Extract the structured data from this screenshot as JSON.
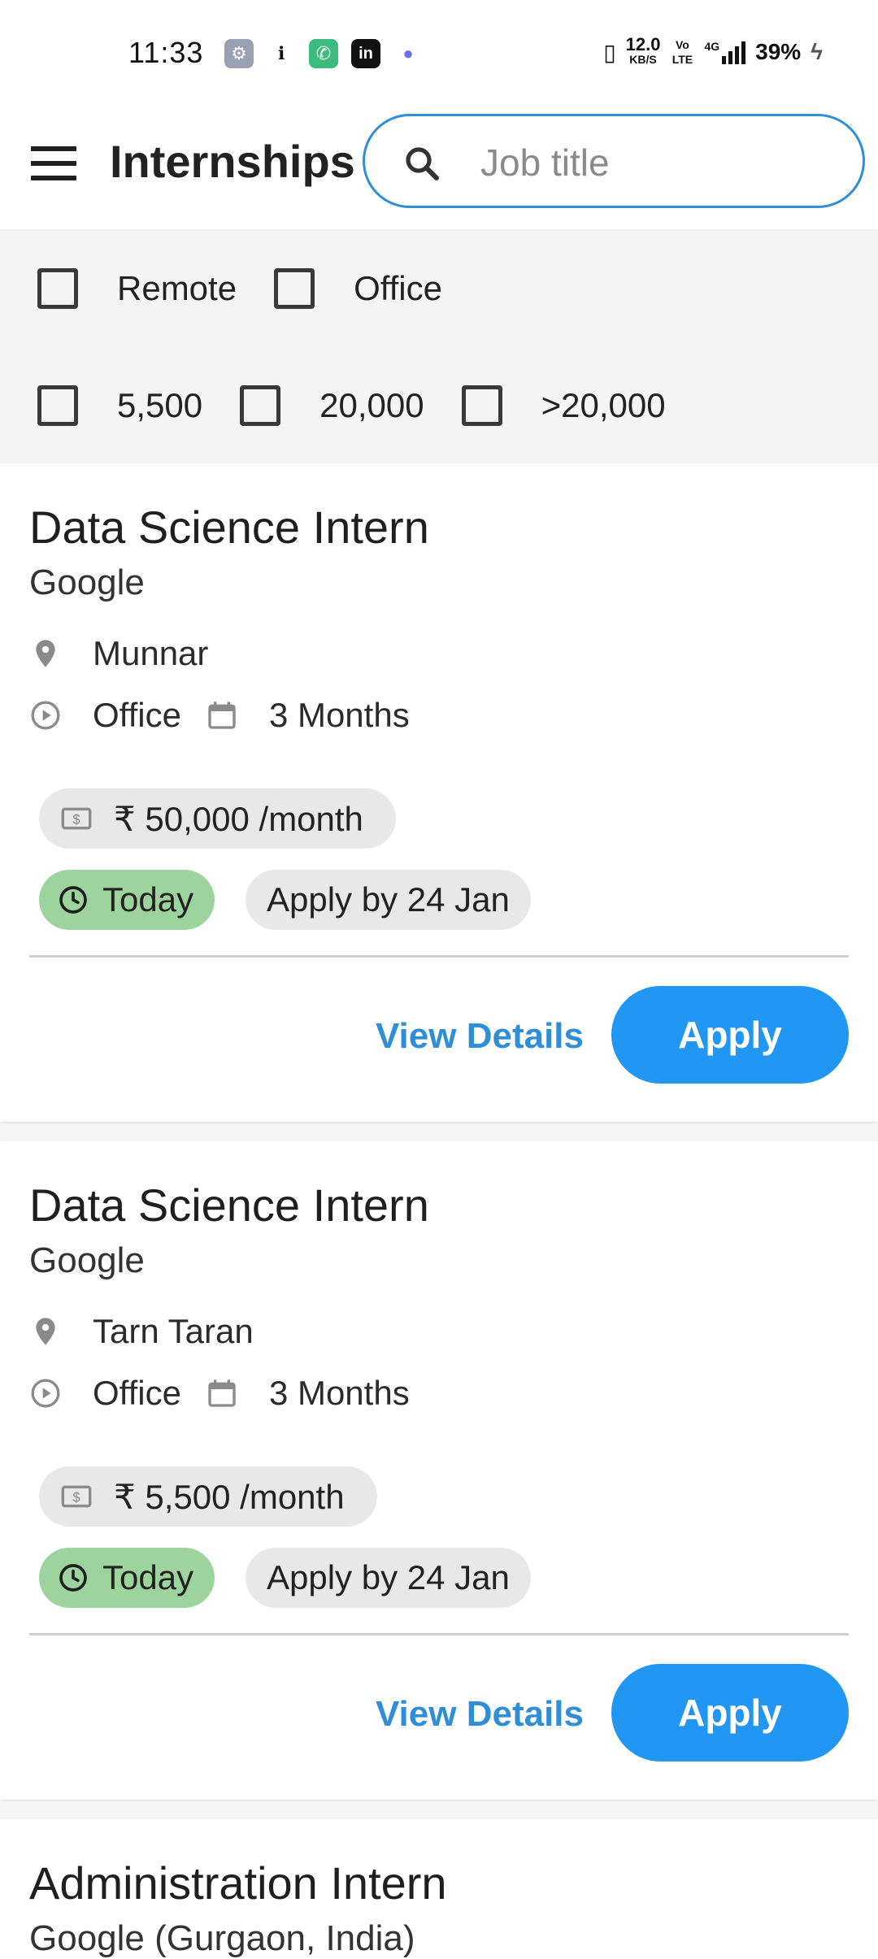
{
  "status_bar": {
    "time": "11:33",
    "speed_value": "12.0",
    "speed_unit": "KB/S",
    "volte": "Vo LTE",
    "network": "4G",
    "battery": "39%"
  },
  "app_bar": {
    "title": "Internships",
    "search_placeholder": "Job title"
  },
  "filters": {
    "row1": [
      "Remote",
      "Office"
    ],
    "row2": [
      "5,500",
      "20,000",
      ">20,000"
    ]
  },
  "listings": [
    {
      "title": "Data Science Intern",
      "company": "Google",
      "location": "Munnar",
      "work_type": "Office",
      "duration": "3 Months",
      "stipend": "₹ 50,000 /month",
      "posted": "Today",
      "deadline": "Apply by 24 Jan",
      "view_label": "View Details",
      "apply_label": "Apply"
    },
    {
      "title": "Data Science Intern",
      "company": "Google",
      "location": "Tarn Taran",
      "work_type": "Office",
      "duration": "3 Months",
      "stipend": "₹ 5,500 /month",
      "posted": "Today",
      "deadline": "Apply by 24 Jan",
      "view_label": "View Details",
      "apply_label": "Apply"
    },
    {
      "title": "Administration Intern",
      "company": "Google (Gurgaon, India)"
    }
  ],
  "colors": {
    "accent": "#2196f3",
    "link": "#2f8ed8",
    "posted_chip": "#9dd39d",
    "filter_bg": "#f4f4f4"
  }
}
